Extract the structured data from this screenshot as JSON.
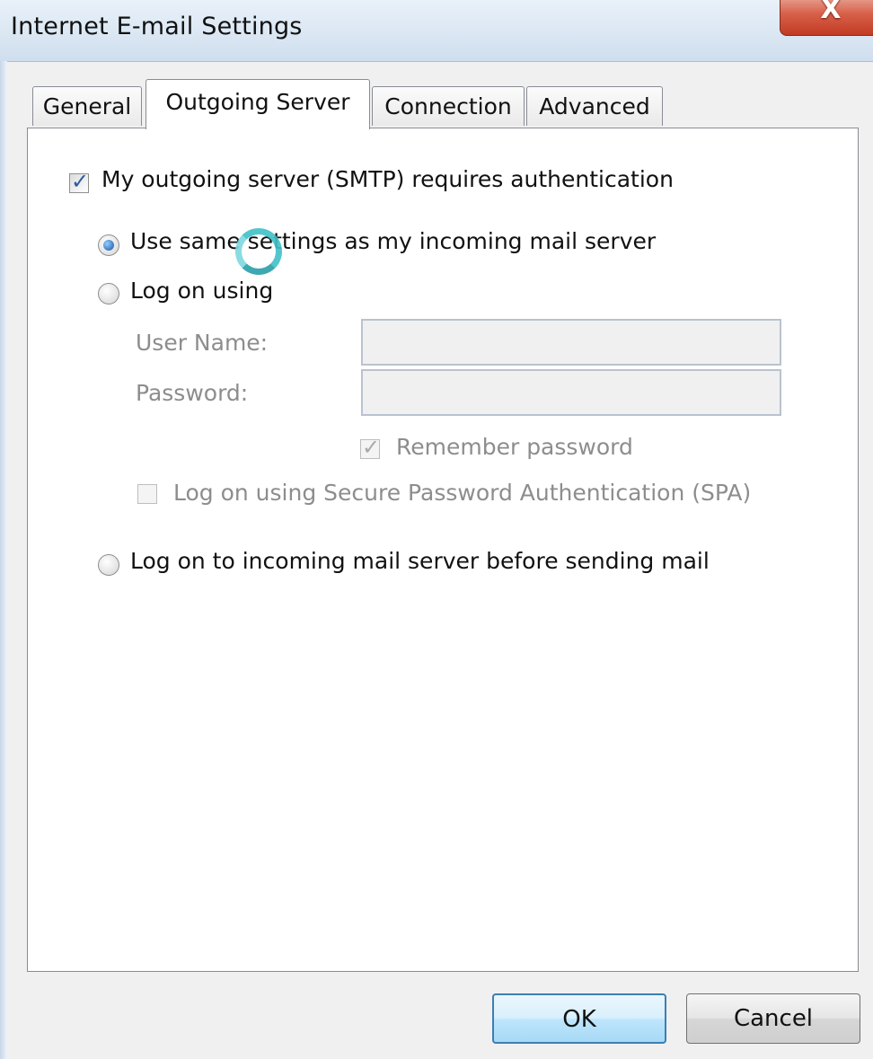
{
  "window": {
    "title": "Internet E-mail Settings",
    "close_glyph": "X"
  },
  "tabs": [
    {
      "label": "General",
      "active": false
    },
    {
      "label": "Outgoing Server",
      "active": true
    },
    {
      "label": "Connection",
      "active": false
    },
    {
      "label": "Advanced",
      "active": false
    }
  ],
  "outgoing": {
    "requires_auth_label": "My outgoing server (SMTP) requires authentication",
    "requires_auth_checked": true,
    "same_settings_label": "Use same settings as my incoming mail server",
    "same_settings_selected": true,
    "logon_using_label": "Log on using",
    "logon_using_selected": false,
    "username_label": "User Name:",
    "username_value": "",
    "password_label": "Password:",
    "password_value": "",
    "remember_password_label": "Remember password",
    "remember_password_checked": true,
    "spa_label": "Log on using Secure Password Authentication (SPA)",
    "spa_checked": false,
    "logon_incoming_label": "Log on to incoming mail server before sending mail",
    "logon_incoming_selected": false
  },
  "buttons": {
    "ok_label": "OK",
    "cancel_label": "Cancel"
  },
  "icons": {
    "check": "✓",
    "busy_cursor": "busy-spinner-icon"
  },
  "colors": {
    "accent": "#3c7fb1",
    "close_red": "#c23a22",
    "cursor_teal": "#3fc0c8"
  }
}
